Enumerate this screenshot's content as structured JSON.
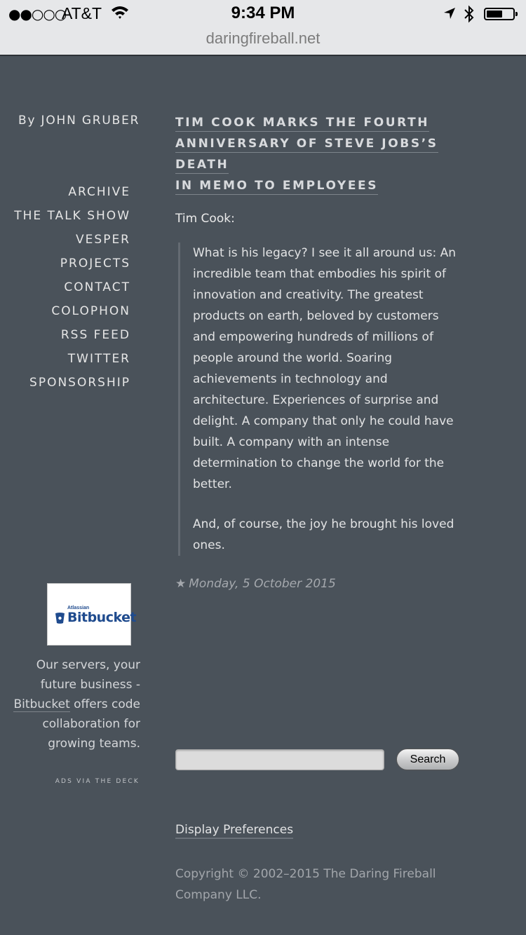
{
  "status_bar": {
    "signal": "●●○○○",
    "carrier": "AT&T",
    "time": "9:34 PM",
    "battery_level": 0.6
  },
  "browser": {
    "url": "daringfireball.net"
  },
  "sidebar": {
    "byline": "By JOHN GRUBER",
    "nav": [
      {
        "label": "ARCHIVE"
      },
      {
        "label": "THE TALK SHOW"
      },
      {
        "label": "VESPER"
      },
      {
        "label": "PROJECTS"
      },
      {
        "label": "CONTACT"
      },
      {
        "label": "COLOPHON"
      },
      {
        "label": "RSS FEED"
      },
      {
        "label": "TWITTER"
      },
      {
        "label": "SPONSORSHIP"
      }
    ],
    "ad": {
      "logo_small": "Atlassian",
      "logo_big": "Bitbucket",
      "text_before": "Our servers, your future business - ",
      "link": "Bitbucket",
      "text_after": " offers code collaboration for growing teams.",
      "via": "ADS VIA THE DECK"
    }
  },
  "article": {
    "title_lines": [
      "TIM COOK MARKS THE FOURTH",
      "ANNIVERSARY OF STEVE JOBS’S DEATH",
      "IN MEMO TO EMPLOYEES"
    ],
    "intro": "Tim Cook:",
    "quote": [
      "What is his legacy? I see it all around us: An incredible team that embodies his spirit of innovation and creativity. The greatest products on earth, beloved by customers and empowering hundreds of millions of people around the world. Soaring achievements in technology and architecture. Experiences of surprise and delight. A company that only he could have built. A company with an intense determination to change the world for the better.",
      "And, of course, the joy he brought his loved ones."
    ],
    "star": "★",
    "date": "Monday, 5 October 2015"
  },
  "search": {
    "value": "",
    "button_label": "Search"
  },
  "footer": {
    "display_prefs": "Display Preferences",
    "copyright": "Copyright © 2002–2015 The Daring Fireball Company LLC."
  }
}
